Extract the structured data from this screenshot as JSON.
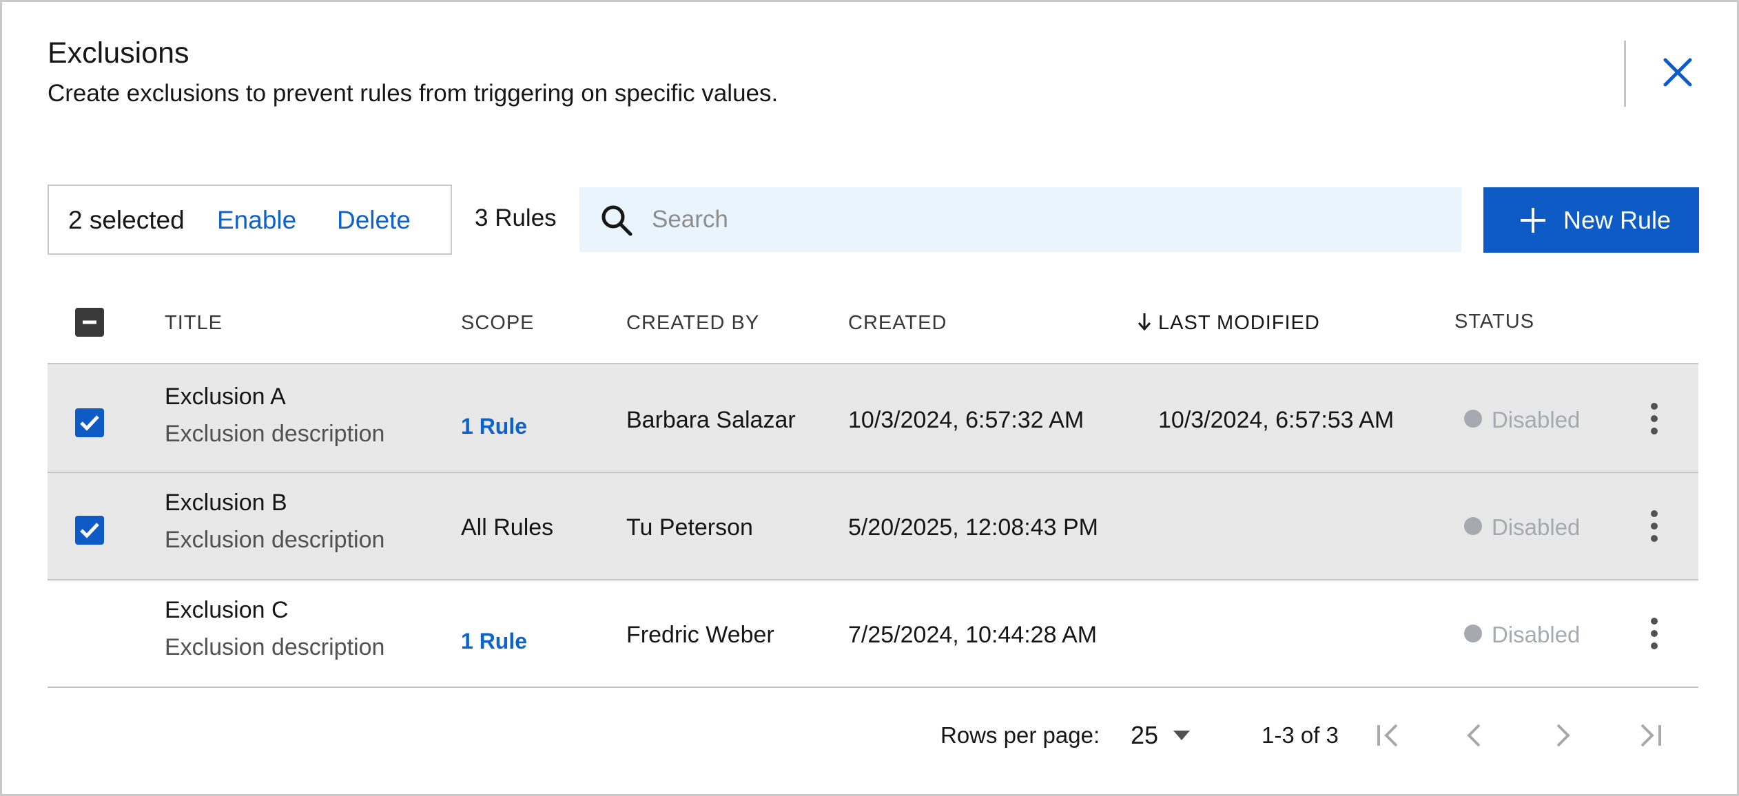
{
  "dialog": {
    "title": "Exclusions",
    "subtitle": "Create exclusions to prevent rules from triggering on specific values.",
    "close_icon": "close-icon"
  },
  "toolbar": {
    "selected_label": "2 selected",
    "enable_label": "Enable",
    "delete_label": "Delete",
    "rules_count": "3 Rules",
    "search_placeholder": "Search",
    "search_value": "",
    "new_rule_label": "New Rule"
  },
  "table": {
    "headers": {
      "title": "TITLE",
      "scope": "SCOPE",
      "created_by": "CREATED BY",
      "created": "CREATED",
      "last_modified": "LAST MODIFIED",
      "status": "STATUS"
    },
    "sort": {
      "column": "last_modified",
      "direction": "descending"
    },
    "rows": [
      {
        "title": "Exclusion A",
        "description": "Exclusion description",
        "scope": "1 Rule",
        "scope_is_link": true,
        "created_by": "Barbara Salazar",
        "created": "10/3/2024, 6:57:32 AM",
        "last_modified": "10/3/2024, 6:57:53 AM",
        "status": "Disabled",
        "selected": true
      },
      {
        "title": "Exclusion B",
        "description": "Exclusion description",
        "scope": "All Rules",
        "scope_is_link": false,
        "created_by": "Tu Peterson",
        "created": "5/20/2025, 12:08:43 PM",
        "last_modified": "",
        "status": "Disabled",
        "selected": true
      },
      {
        "title": "Exclusion C",
        "description": "Exclusion description",
        "scope": "1 Rule",
        "scope_is_link": true,
        "created_by": "Fredric Weber",
        "created": "7/25/2024, 10:44:28 AM",
        "last_modified": "",
        "status": "Disabled",
        "selected": false
      }
    ]
  },
  "pagination": {
    "rows_per_page_label": "Rows per page:",
    "rows_per_page": "25",
    "range": "1-3 of 3"
  },
  "colors": {
    "accent": "#0f5bc6",
    "link": "#0f62c9",
    "search_bg": "#eaf4fc",
    "selected_row_bg": "#e8e8e8",
    "status_disabled": "#a6a9b0"
  }
}
